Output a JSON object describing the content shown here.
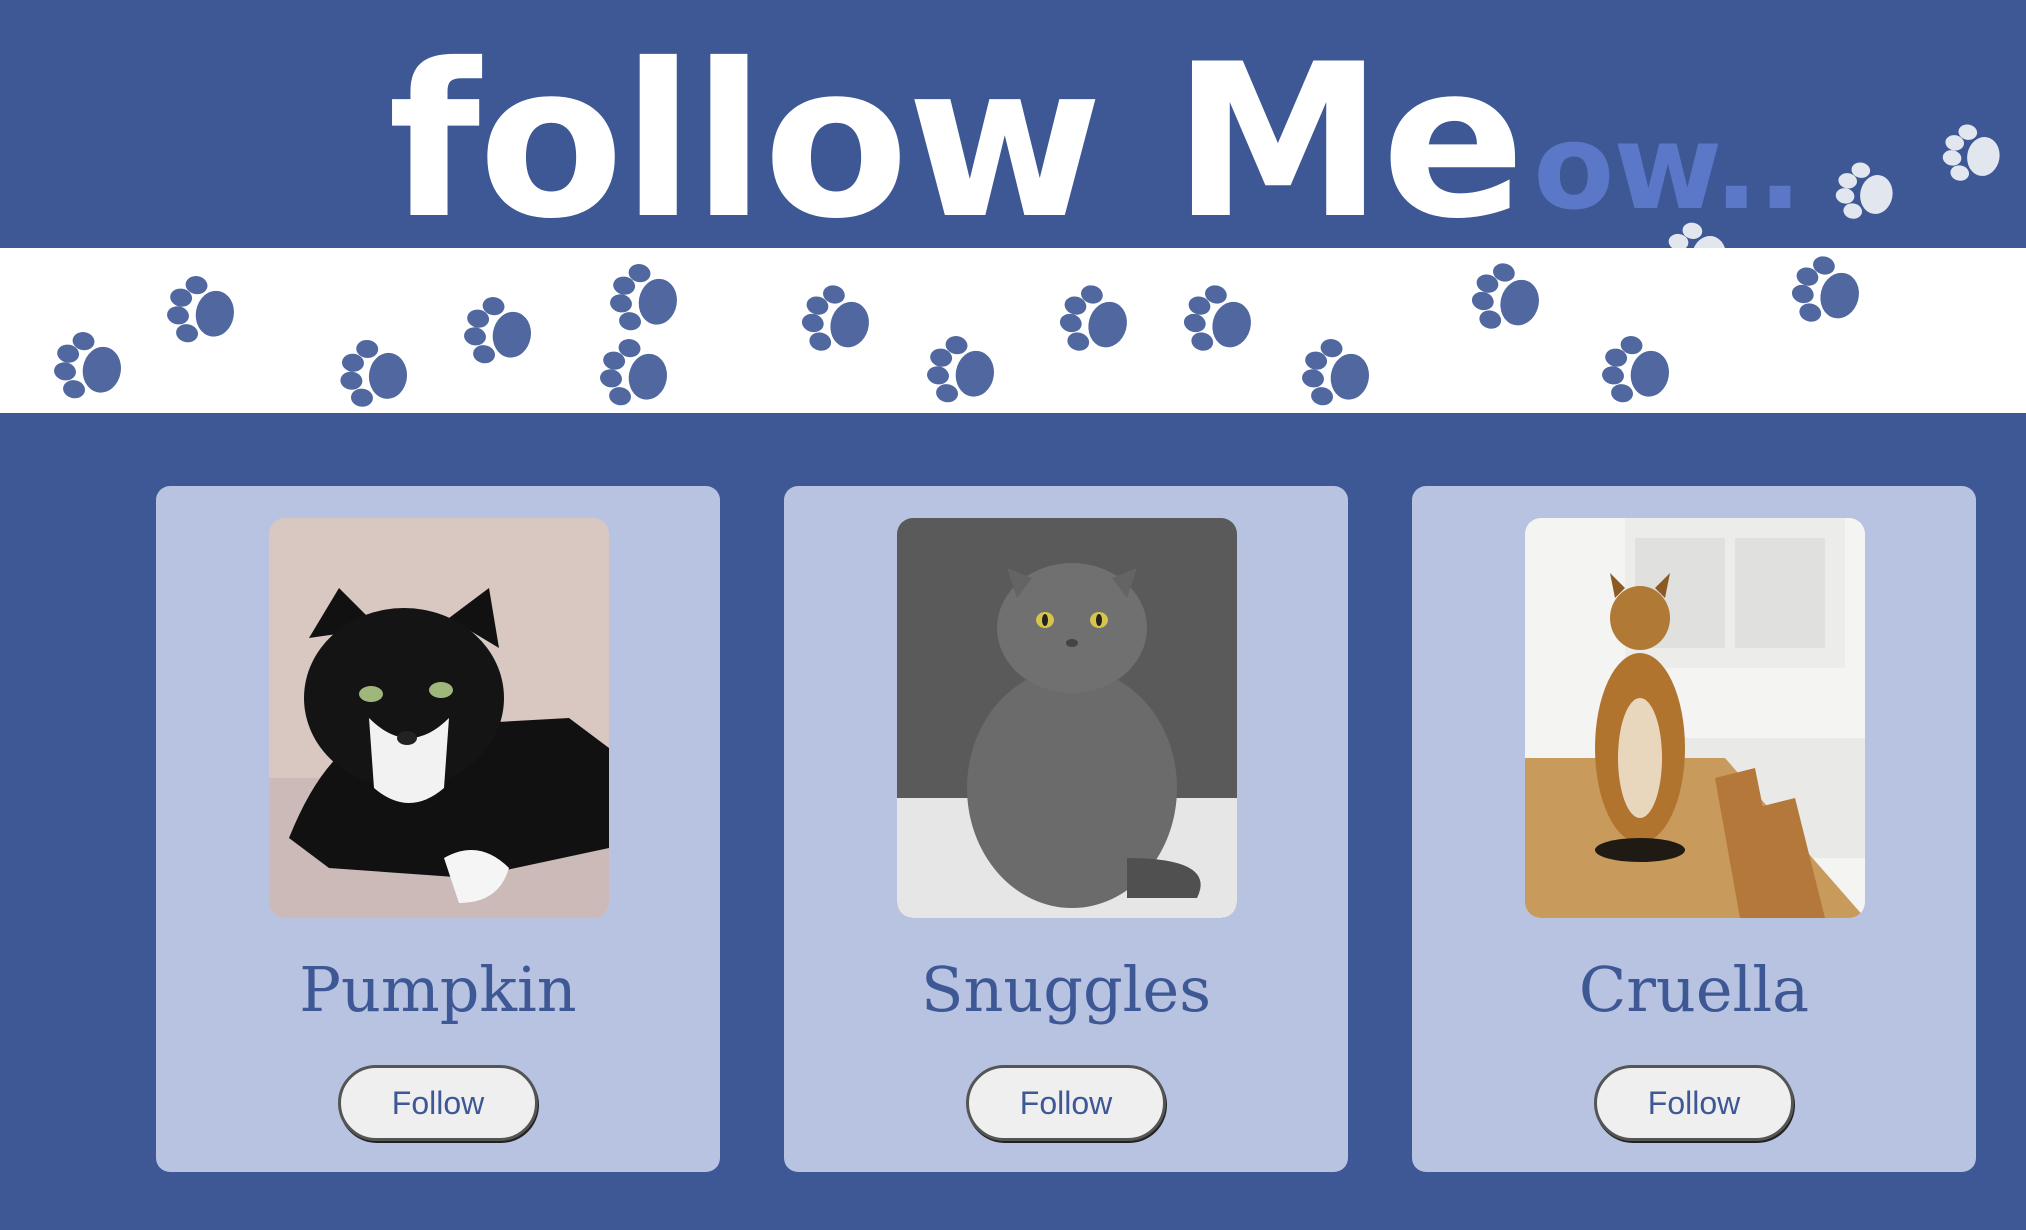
{
  "header": {
    "logo_main": "follow Me",
    "logo_suffix": "ow.."
  },
  "cards": [
    {
      "name": "Pumpkin",
      "button_label": "Follow",
      "photo": "black-and-white-tuxedo-cat"
    },
    {
      "name": "Snuggles",
      "button_label": "Follow",
      "photo": "grey-scottish-fold-cat"
    },
    {
      "name": "Cruella",
      "button_label": "Follow",
      "photo": "bengal-cat-on-table"
    }
  ],
  "colors": {
    "background": "#3e5895",
    "card": "#b7c3e1",
    "paw": "#3e5895",
    "logo_suffix": "#5a78c7",
    "text": "#3e5895"
  }
}
